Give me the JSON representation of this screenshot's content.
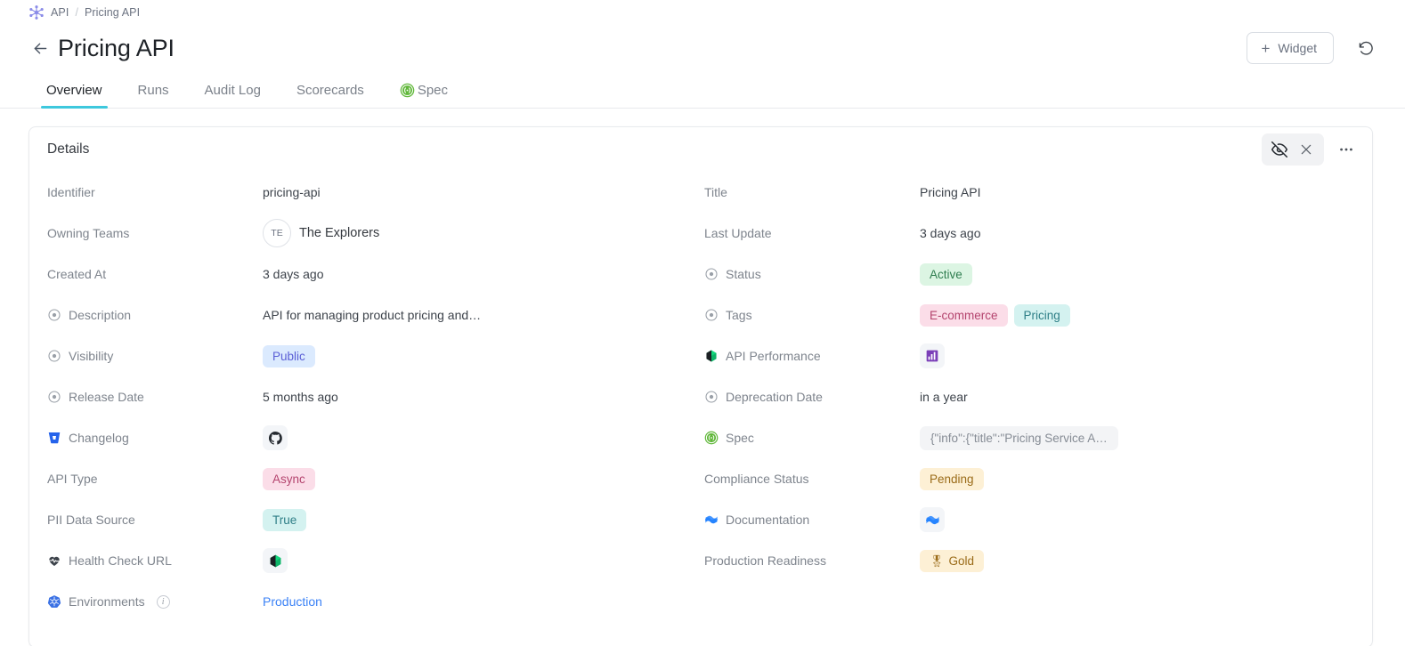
{
  "breadcrumb": {
    "icon": "node-cluster-icon",
    "items": [
      "API",
      "Pricing API"
    ],
    "separator": "/"
  },
  "header": {
    "back_icon": "arrow-left-icon",
    "title": "Pricing API",
    "add_widget_label": "Widget",
    "add_widget_plus": "+",
    "refresh_icon": "refresh-icon"
  },
  "tabs": [
    {
      "label": "Overview",
      "active": true,
      "icon": null
    },
    {
      "label": "Runs",
      "active": false,
      "icon": null
    },
    {
      "label": "Audit Log",
      "active": false,
      "icon": null
    },
    {
      "label": "Scorecards",
      "active": false,
      "icon": null
    },
    {
      "label": "Spec",
      "active": false,
      "icon": "swagger-icon"
    }
  ],
  "card": {
    "title": "Details",
    "actions": {
      "hide_icon": "eye-off-icon",
      "close_icon": "close-icon",
      "more_icon": "more-horizontal-icon"
    }
  },
  "details": {
    "left": [
      {
        "label": "Identifier",
        "label_icon": null,
        "value": "pricing-api",
        "type": "text"
      },
      {
        "label": "Owning Teams",
        "label_icon": null,
        "value": "The Explorers",
        "avatar": "TE",
        "type": "team"
      },
      {
        "label": "Created At",
        "label_icon": null,
        "value": "3 days ago",
        "type": "text"
      },
      {
        "label": "Description",
        "label_icon": "target-icon",
        "value": "API for managing product pricing and…",
        "type": "text"
      },
      {
        "label": "Visibility",
        "label_icon": "target-icon",
        "value": "Public",
        "type": "chip",
        "chip_color": "blue"
      },
      {
        "label": "Release Date",
        "label_icon": "target-icon",
        "value": "5 months ago",
        "type": "text"
      },
      {
        "label": "Changelog",
        "label_icon": "bitbucket-icon",
        "value": "",
        "type": "tile",
        "tile_icon": "github-icon"
      },
      {
        "label": "API Type",
        "label_icon": null,
        "value": "Async",
        "type": "chip",
        "chip_color": "pink"
      },
      {
        "label": "PII Data Source",
        "label_icon": null,
        "value": "True",
        "type": "chip",
        "chip_color": "teal"
      },
      {
        "label": "Health Check URL",
        "label_icon": "heart-pulse-icon",
        "value": "",
        "type": "tile",
        "tile_icon": "cube-green-icon"
      },
      {
        "label": "Environments",
        "label_icon": "kubernetes-icon",
        "value": "Production",
        "type": "link",
        "has_info": true
      }
    ],
    "right": [
      {
        "label": "Title",
        "label_icon": null,
        "value": "Pricing API",
        "type": "text"
      },
      {
        "label": "Last Update",
        "label_icon": null,
        "value": "3 days ago",
        "type": "text"
      },
      {
        "label": "Status",
        "label_icon": "target-icon",
        "value": "Active",
        "type": "chip",
        "chip_color": "green"
      },
      {
        "label": "Tags",
        "label_icon": "target-icon",
        "type": "chips",
        "values": [
          {
            "text": "E-commerce",
            "chip_color": "pink"
          },
          {
            "text": "Pricing",
            "chip_color": "teal"
          }
        ]
      },
      {
        "label": "API Performance",
        "label_icon": "cube-green-icon",
        "value": "",
        "type": "tile",
        "tile_icon": "grafana-purple-icon"
      },
      {
        "label": "Deprecation Date",
        "label_icon": "target-icon",
        "value": "in a year",
        "type": "text"
      },
      {
        "label": "Spec",
        "label_icon": "swagger-icon",
        "value": "{\"info\":{\"title\":\"Pricing Service A…",
        "type": "chip",
        "chip_color": "mono"
      },
      {
        "label": "Compliance Status",
        "label_icon": null,
        "value": "Pending",
        "type": "chip",
        "chip_color": "amber"
      },
      {
        "label": "Documentation",
        "label_icon": "confluence-icon",
        "value": "",
        "type": "tile",
        "tile_icon": "confluence-icon"
      },
      {
        "label": "Production Readiness",
        "label_icon": null,
        "value": "Gold",
        "type": "chip",
        "chip_color": "amber",
        "prefix_glyph": "🎖"
      }
    ]
  },
  "colors": {
    "accent_tab": "#3ec8dd",
    "link": "#3b82f6",
    "brand_purple": "#8b8ce8",
    "swagger_green": "#61b83b",
    "bitbucket_blue": "#2563eb",
    "kubernetes_blue": "#3970e4",
    "confluence_blue": "#2684ff"
  }
}
